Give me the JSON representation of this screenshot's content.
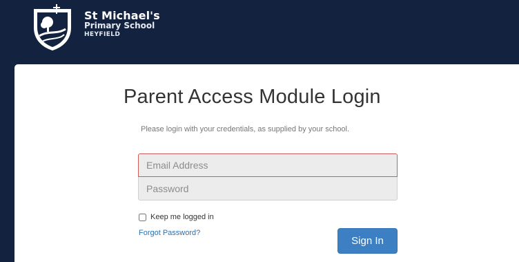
{
  "header": {
    "school_name": "St Michael's",
    "school_subtitle": "Primary School",
    "school_town": "HEYFIELD",
    "logo_icon": "school-crest-icon"
  },
  "login": {
    "title": "Parent Access Module Login",
    "intro": "Please login with your credentials, as supplied by your school.",
    "email_placeholder": "Email Address",
    "email_value": "",
    "password_placeholder": "Password",
    "password_value": "",
    "remember_label": "Keep me logged in",
    "remember_checked": false,
    "forgot_label": "Forgot Password?",
    "signin_label": "Sign In"
  },
  "colors": {
    "header_bg": "#13233f",
    "panel_bg": "#ffffff",
    "button_bg": "#3c7fc2",
    "link": "#2a6fb0",
    "error_border": "#cf5c5c"
  }
}
